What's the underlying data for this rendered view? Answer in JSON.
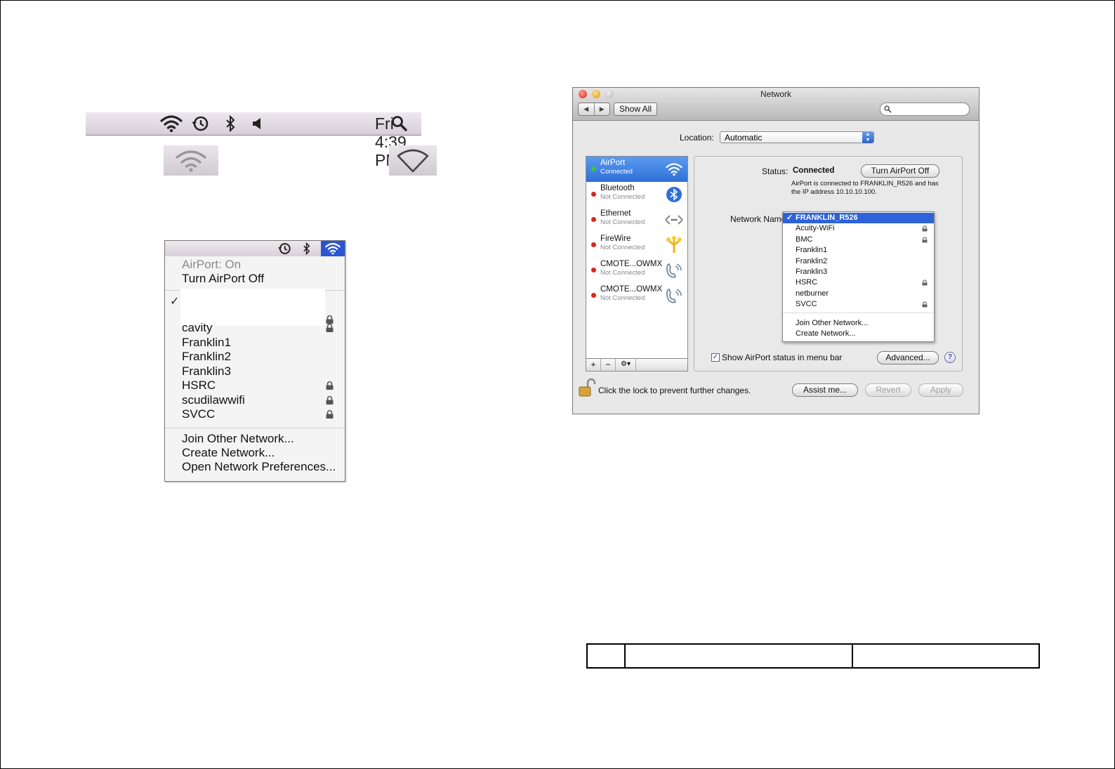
{
  "menubar": {
    "clock": "Fri 4:39 PM",
    "icons": [
      "wifi-icon",
      "time-machine-icon",
      "bluetooth-icon",
      "volume-icon",
      "spotlight-icon"
    ]
  },
  "samples": {
    "left_icon": "wifi-dimmed-icon",
    "right_icon": "wifi-empty-icon"
  },
  "airport_menu": {
    "status": "AirPort: On",
    "toggle": "Turn AirPort Off",
    "networks": [
      {
        "name": "cavity",
        "locked": true
      },
      {
        "name": "Franklin1",
        "locked": false
      },
      {
        "name": "Franklin2",
        "locked": false
      },
      {
        "name": "Franklin3",
        "locked": false
      },
      {
        "name": "HSRC",
        "locked": true
      },
      {
        "name": "scudilawwifi",
        "locked": true
      },
      {
        "name": "SVCC",
        "locked": true
      }
    ],
    "actions": [
      "Join Other Network...",
      "Create Network...",
      "Open Network Preferences..."
    ]
  },
  "window": {
    "title": "Network",
    "show_all": "Show All",
    "search_placeholder": "",
    "location_label": "Location:",
    "location_value": "Automatic",
    "services": [
      {
        "name": "AirPort",
        "status": "Connected",
        "dot": "#3cc43c",
        "icon": "airport-icon",
        "selected": true
      },
      {
        "name": "Bluetooth",
        "status": "Not Connected",
        "dot": "#d9261c",
        "icon": "bluetooth-icon",
        "selected": false
      },
      {
        "name": "Ethernet",
        "status": "Not Connected",
        "dot": "#d9261c",
        "icon": "ethernet-icon",
        "selected": false
      },
      {
        "name": "FireWire",
        "status": "Not Connected",
        "dot": "#d9261c",
        "icon": "firewire-icon",
        "selected": false
      },
      {
        "name": "CMOTE...OWMX",
        "status": "Not Connected",
        "dot": "#d9261c",
        "icon": "modem-icon",
        "selected": false
      },
      {
        "name": "CMOTE...OWMX",
        "status": "Not Connected",
        "dot": "#d9261c",
        "icon": "modem-icon",
        "selected": false
      }
    ],
    "service_tools": [
      "+",
      "−",
      "⚙▾"
    ],
    "status_label": "Status:",
    "status_value": "Connected",
    "turn_off": "Turn AirPort Off",
    "status_desc": "AirPort is connected to FRANKLIN_R526 and has the IP address 10.10.10.100.",
    "network_name_label": "Network Name",
    "network_popup": [
      {
        "name": "FRANKLIN_R526",
        "checked": true,
        "locked": false
      },
      {
        "name": "Acuity-WiFi",
        "checked": false,
        "locked": true
      },
      {
        "name": "BMC",
        "checked": false,
        "locked": true
      },
      {
        "name": "Franklin1",
        "checked": false,
        "locked": false
      },
      {
        "name": "Franklin2",
        "checked": false,
        "locked": false
      },
      {
        "name": "Franklin3",
        "checked": false,
        "locked": false
      },
      {
        "name": "HSRC",
        "checked": false,
        "locked": true
      },
      {
        "name": "netburner",
        "checked": false,
        "locked": false
      },
      {
        "name": "SVCC",
        "checked": false,
        "locked": true
      }
    ],
    "network_actions": [
      "Join Other Network...",
      "Create Network..."
    ],
    "show_status_label": "Show AirPort status in menu bar",
    "show_status_checked": true,
    "advanced": "Advanced...",
    "help": "?",
    "lock_text": "Click the lock to prevent further changes.",
    "assist": "Assist me...",
    "revert": "Revert",
    "apply": "Apply"
  },
  "colors": {
    "selection_blue": "#2d62d8",
    "menubar_wifi_bg": "#2b55d6",
    "connected_dot": "#3cc43c",
    "disconnected_dot": "#d9261c"
  }
}
